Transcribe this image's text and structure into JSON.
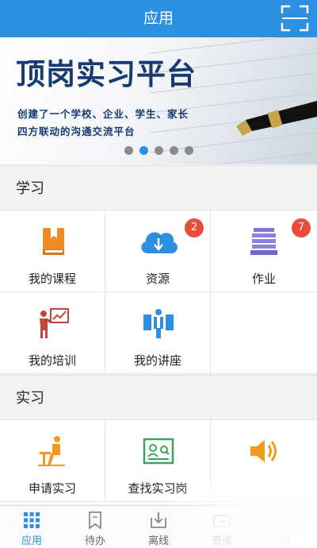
{
  "header": {
    "title": "应用",
    "scan_icon": "scan-icon"
  },
  "banner": {
    "headline": "顶岗实习平台",
    "subline1": "创建了一个学校、企业、学生、家长",
    "subline2": "四方联动的沟通交流平台",
    "slides_total": 5,
    "active_slide": 2
  },
  "sections": {
    "study": {
      "title": "学习",
      "items": [
        {
          "label": "我的课程",
          "icon": "book-icon"
        },
        {
          "label": "资源",
          "icon": "cloud-download-icon",
          "badge": "2"
        },
        {
          "label": "作业",
          "icon": "stack-icon",
          "badge": "7"
        },
        {
          "label": "我的培训",
          "icon": "training-icon"
        },
        {
          "label": "我的讲座",
          "icon": "lecture-icon"
        }
      ]
    },
    "internship": {
      "title": "实习",
      "items": [
        {
          "label": "申请实习",
          "icon": "apply-desk-icon"
        },
        {
          "label": "查找实习岗",
          "icon": "job-search-icon"
        },
        {
          "label": "",
          "icon": "speaker-icon"
        }
      ]
    }
  },
  "tabbar": {
    "items": [
      {
        "label": "应用",
        "icon": "grid-icon",
        "active": true
      },
      {
        "label": "待办",
        "icon": "bookmark-icon"
      },
      {
        "label": "离线",
        "icon": "download-box-icon"
      },
      {
        "label": "直播",
        "icon": "live-icon"
      },
      {
        "label": "我",
        "icon": "user-icon"
      }
    ]
  },
  "colors": {
    "primary": "#2c8fe0",
    "badge": "#e74c3c",
    "orange": "#f39a1e",
    "headline": "#173a72"
  }
}
